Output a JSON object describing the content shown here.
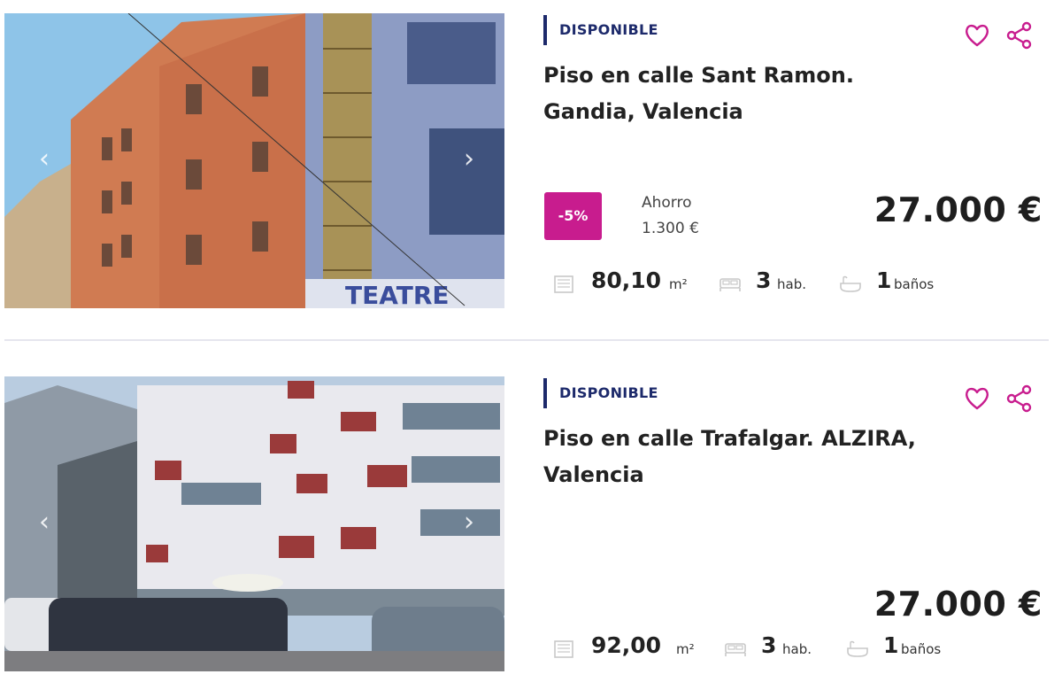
{
  "listings": [
    {
      "status": "DISPONIBLE",
      "title": "Piso en calle Sant Ramon. Gandia, Valencia",
      "discount": "-5%",
      "saving_label": "Ahorro",
      "saving_value": "1.300 €",
      "price": "27.000 €",
      "area_value": "80,10",
      "area_unit": "m²",
      "rooms_value": "3",
      "rooms_unit": "hab.",
      "baths_value": "1",
      "baths_unit": "baños",
      "photo_sign": "TEATRE"
    },
    {
      "status": "DISPONIBLE",
      "title": "Piso en calle Trafalgar. ALZIRA, Valencia",
      "price": "27.000 €",
      "area_value": "92,00",
      "area_unit": "m²",
      "rooms_value": "3",
      "rooms_unit": "hab.",
      "baths_value": "1",
      "baths_unit": "baños"
    }
  ],
  "icons": {
    "favorite": "heart-icon",
    "share": "share-icon",
    "area": "area-icon",
    "rooms": "bed-icon",
    "baths": "bath-icon",
    "prev": "chevron-left-icon",
    "next": "chevron-right-icon"
  },
  "colors": {
    "accent": "#c81c8e",
    "status": "#1d2a6b",
    "divider": "#e6e6ee"
  },
  "arrows": {
    "prev": "‹",
    "next": "›"
  }
}
